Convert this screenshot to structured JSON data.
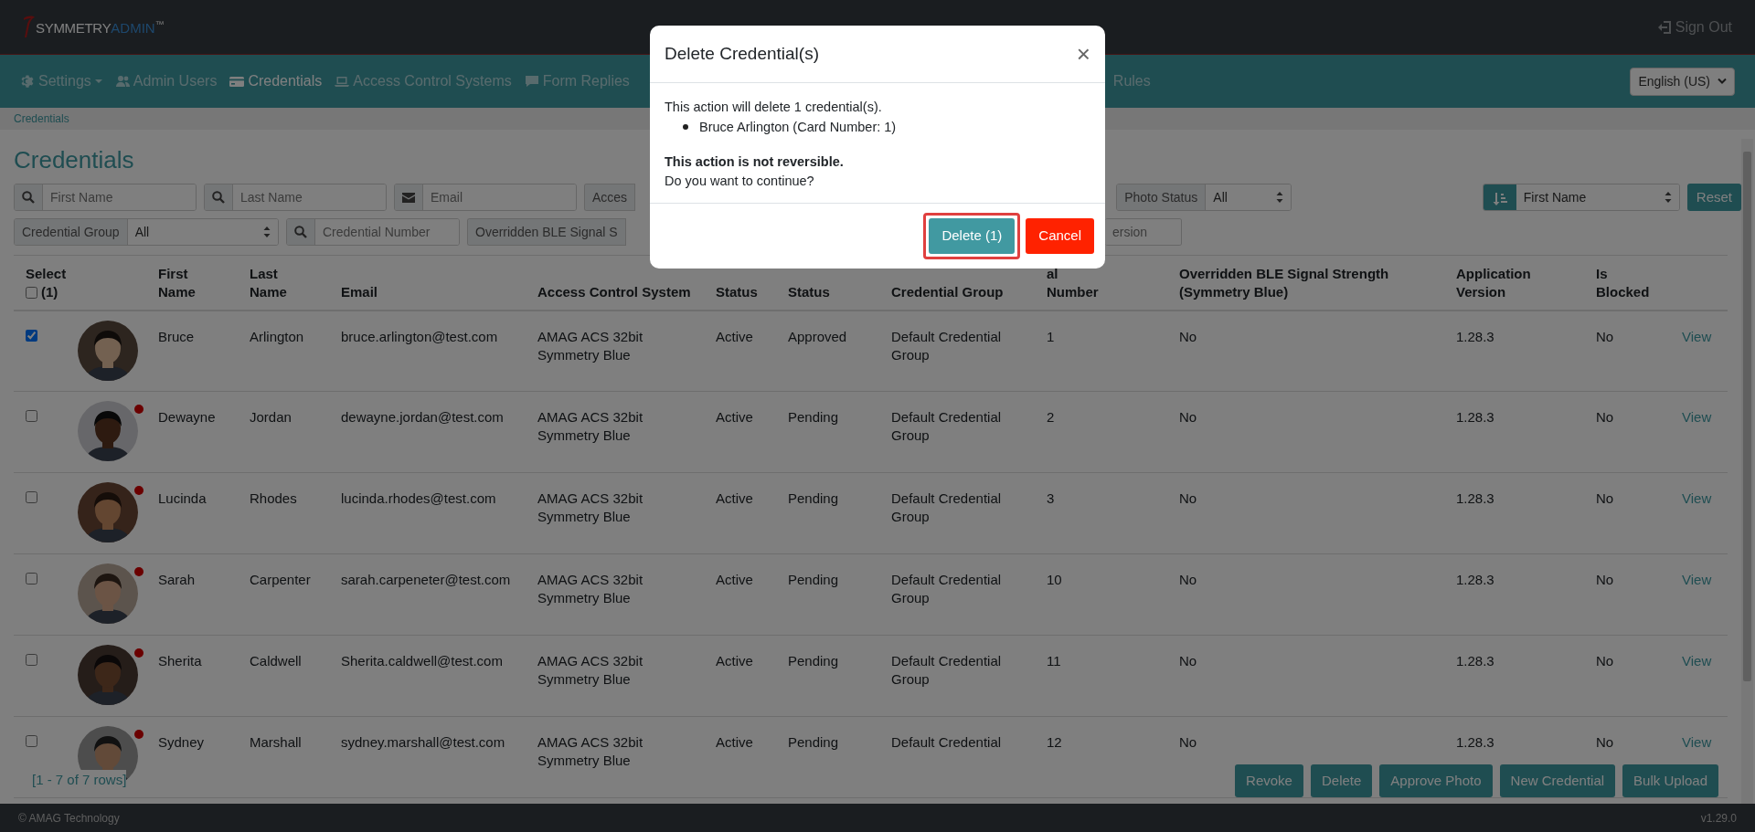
{
  "header": {
    "logo": {
      "word_1": "SYMMETRY",
      "word_2": "ADMIN",
      "trademark": "™"
    },
    "sign_out": "Sign Out"
  },
  "nav": {
    "items": [
      {
        "label": "Settings",
        "dropdown": true,
        "selected": false
      },
      {
        "label": "Admin Users",
        "dropdown": false,
        "selected": false
      },
      {
        "label": "Credentials",
        "dropdown": false,
        "selected": true
      },
      {
        "label": "Access Control Systems",
        "dropdown": false,
        "selected": false
      },
      {
        "label": "Form Replies",
        "dropdown": false,
        "selected": false
      },
      {
        "label": "Rules",
        "dropdown": false,
        "selected": false
      }
    ],
    "language": "English (US)"
  },
  "breadcrumb": "Credentials",
  "title": "Credentials",
  "filters": {
    "row_1": [
      {
        "kind": "search",
        "placeholder": "First Name"
      },
      {
        "kind": "search",
        "placeholder": "Last Name"
      },
      {
        "kind": "email",
        "placeholder": "Email"
      },
      {
        "kind": "label",
        "label": "Acces"
      },
      {
        "kind": "select",
        "label": "Photo Status",
        "value": "All"
      },
      {
        "kind": "sort",
        "value": "First Name"
      },
      {
        "kind": "button",
        "label": "Reset"
      }
    ],
    "row_2": [
      {
        "kind": "select",
        "label": "Credential Group",
        "value": "All"
      },
      {
        "kind": "search",
        "placeholder": "Credential Number"
      },
      {
        "kind": "label",
        "label": "Overridden BLE Signal S"
      },
      {
        "kind": "text",
        "placeholder": "ersion"
      }
    ]
  },
  "table": {
    "select_all": {
      "label": "Select",
      "checked": false,
      "count": "(1)"
    },
    "columns": [
      "First Name",
      "Last Name",
      "Email",
      "Access Control System",
      "Status",
      "Status",
      "Credential Group",
      "al Number",
      "Overridden BLE Signal Strength (Symmetry Blue)",
      "Application Version",
      "Is Blocked"
    ],
    "rows": [
      {
        "selected": true,
        "alert": false,
        "cells": [
          "Bruce",
          "Arlington",
          "bruce.arlington@test.com",
          "AMAG ACS 32bit Symmetry Blue",
          "Active",
          "Approved",
          "Default Credential Group",
          "1",
          "No",
          "1.28.3",
          "No"
        ],
        "action": "View"
      },
      {
        "selected": false,
        "alert": true,
        "cells": [
          "Dewayne",
          "Jordan",
          "dewayne.jordan@test.com",
          "AMAG ACS 32bit Symmetry Blue",
          "Active",
          "Pending",
          "Default Credential Group",
          "2",
          "No",
          "1.28.3",
          "No"
        ],
        "action": "View"
      },
      {
        "selected": false,
        "alert": true,
        "cells": [
          "Lucinda",
          "Rhodes",
          "lucinda.rhodes@test.com",
          "AMAG ACS 32bit Symmetry Blue",
          "Active",
          "Pending",
          "Default Credential Group",
          "3",
          "No",
          "1.28.3",
          "No"
        ],
        "action": "View"
      },
      {
        "selected": false,
        "alert": true,
        "cells": [
          "Sarah",
          "Carpenter",
          "sarah.carpeneter@test.com",
          "AMAG ACS 32bit Symmetry Blue",
          "Active",
          "Pending",
          "Default Credential Group",
          "10",
          "No",
          "1.28.3",
          "No"
        ],
        "action": "View"
      },
      {
        "selected": false,
        "alert": true,
        "cells": [
          "Sherita",
          "Caldwell",
          "Sherita.caldwell@test.com",
          "AMAG ACS 32bit Symmetry Blue",
          "Active",
          "Pending",
          "Default Credential Group",
          "11",
          "No",
          "1.28.3",
          "No"
        ],
        "action": "View"
      },
      {
        "selected": false,
        "alert": true,
        "cells": [
          "Sydney",
          "Marshall",
          "sydney.marshall@test.com",
          "AMAG ACS 32bit Symmetry Blue",
          "Active",
          "Pending",
          "Default Credential",
          "12",
          "No",
          "1.28.3",
          "No"
        ],
        "action": "View"
      }
    ],
    "pagination": "[1 - 7 of 7 rows]",
    "actions": [
      "Revoke",
      "Delete",
      "Approve Photo",
      "New Credential",
      "Bulk Upload"
    ]
  },
  "footer": {
    "copyright": "© AMAG Technology",
    "version": "v1.29.0"
  },
  "modal": {
    "title": "Delete Credential(s)",
    "close": "×",
    "message": "This action will delete 1 credential(s).",
    "items": [
      "Bruce Arlington (Card Number: 1)"
    ],
    "warning": "This action is not reversible.",
    "question": "Do you want to continue?",
    "buttons": [
      {
        "label": "Delete (1)",
        "kind": "primary",
        "highlighted": true
      },
      {
        "label": "Cancel",
        "kind": "danger",
        "highlighted": false
      }
    ]
  }
}
